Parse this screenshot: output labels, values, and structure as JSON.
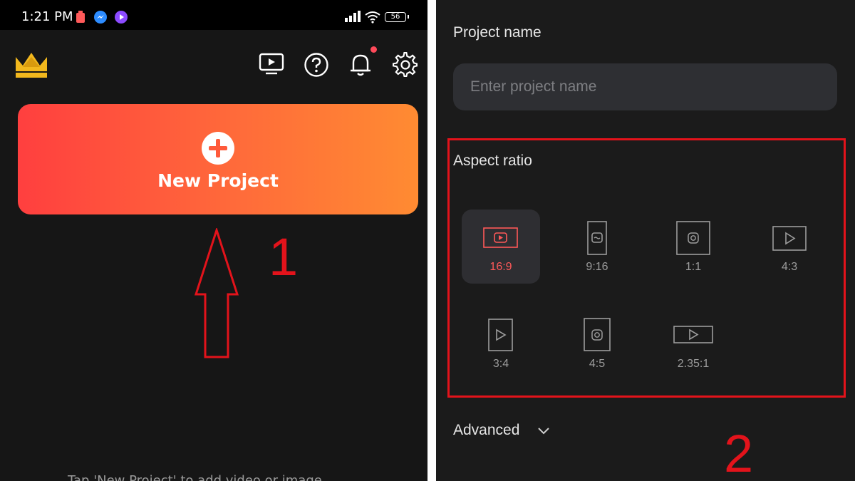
{
  "status_bar": {
    "time": "1:21 PM",
    "battery_level": "56",
    "icons": [
      "battery-saver-icon",
      "messenger-icon",
      "media-app-icon",
      "signal-icon",
      "wifi-icon"
    ]
  },
  "home": {
    "toolbar_icons": [
      "crown-logo-icon",
      "tutorial-play-icon",
      "help-icon",
      "notification-bell-icon",
      "settings-gear-icon"
    ],
    "new_project_label": "New Project",
    "step_one": "1",
    "bottom_hint": "Tap 'New Project' to add video or image"
  },
  "project_setup": {
    "project_name_label": "Project name",
    "project_name_placeholder": "Enter project name",
    "project_name_value": "",
    "aspect_ratio_label": "Aspect ratio",
    "ratios": [
      {
        "label": "16:9",
        "icon": "youtube-frame-icon",
        "selected": true
      },
      {
        "label": "9:16",
        "icon": "tiktok-frame-icon",
        "selected": false
      },
      {
        "label": "1:1",
        "icon": "instagram-square-icon",
        "selected": false
      },
      {
        "label": "4:3",
        "icon": "play-frame-icon",
        "selected": false
      },
      {
        "label": "3:4",
        "icon": "play-portrait-icon",
        "selected": false
      },
      {
        "label": "4:5",
        "icon": "instagram-portrait-icon",
        "selected": false
      },
      {
        "label": "2.35:1",
        "icon": "cinema-wide-icon",
        "selected": false
      }
    ],
    "advanced_label": "Advanced",
    "step_two": "2"
  },
  "colors": {
    "accent_red": "#e3131b",
    "button_gradient_start": "#ff3f3f",
    "button_gradient_end": "#ff8b32",
    "selected_ratio_text": "#ff5858",
    "background": "#161616"
  }
}
